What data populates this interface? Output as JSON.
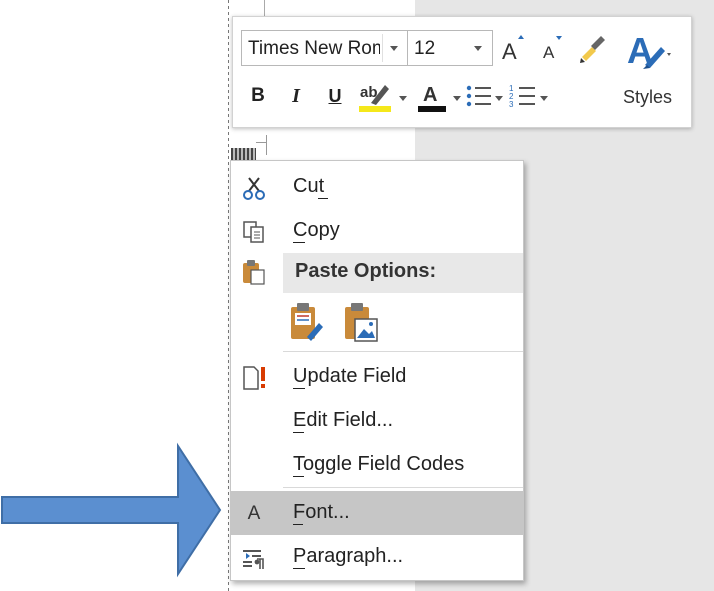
{
  "mini_toolbar": {
    "font_name": "Times New Roman",
    "font_size": "12",
    "styles_label": "Styles",
    "buttons": {
      "bold": "B",
      "italic": "I",
      "underline": "U",
      "highlight": "ab",
      "font_color": "A"
    },
    "highlight_color": "#f5e81b",
    "font_color_swatch": "#111111",
    "accent_color": "#2b6cb7"
  },
  "context_menu": {
    "items": [
      {
        "label": "Cut",
        "icon": "scissors-icon"
      },
      {
        "label": "Copy",
        "icon": "copy-icon"
      },
      {
        "label": "Paste Options:",
        "icon": "paste-icon"
      },
      {
        "label": "Update Field",
        "icon": "update-field-icon"
      },
      {
        "label": "Edit Field...",
        "icon": ""
      },
      {
        "label": "Toggle Field Codes",
        "icon": ""
      },
      {
        "label": "Font...",
        "icon": "font-a-icon",
        "icon_text": "A",
        "highlighted": true
      },
      {
        "label": "Paragraph...",
        "icon": "paragraph-icon"
      }
    ],
    "paste_options": [
      "keep-source-formatting-icon",
      "picture-icon"
    ],
    "highlight_color": "#c6c6c6"
  },
  "pointer": {
    "color": "#5b8fd0",
    "border_color": "#3f6ea6",
    "points_to": "Font..."
  }
}
